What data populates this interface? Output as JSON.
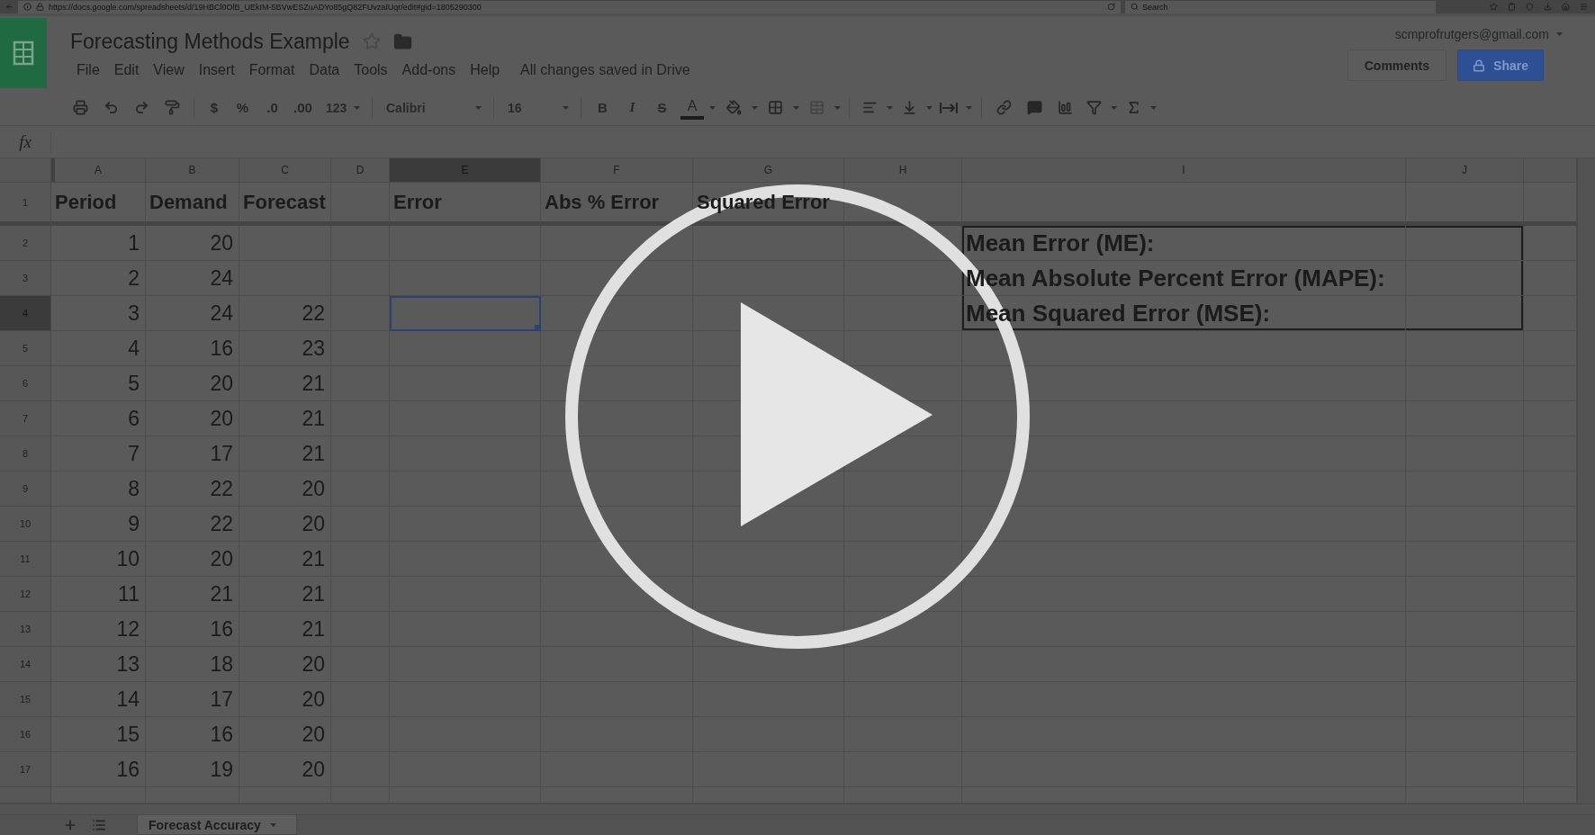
{
  "browser": {
    "url": "https://docs.google.com/spreadsheets/d/19HBCl0OlB_UEkIM-5BVwESZuADYo85gQ82FUvzaIUqr/edit#gid=1805290300",
    "search_placeholder": "Search"
  },
  "document": {
    "title": "Forecasting Methods Example",
    "starred": false,
    "menu": [
      "File",
      "Edit",
      "View",
      "Insert",
      "Format",
      "Data",
      "Tools",
      "Add-ons",
      "Help"
    ],
    "save_status": "All changes saved in Drive"
  },
  "account": {
    "email": "scmprofrutgers@gmail.com"
  },
  "buttons": [
    {
      "label": "Comments",
      "kind": "plain"
    },
    {
      "label": "Share",
      "kind": "primary"
    }
  ],
  "toolbar": {
    "currency": "$",
    "percent": "%",
    "decimal_decrease": ".0",
    "decimal_increase": ".00",
    "number_format": "123",
    "font": "Calibri",
    "font_size": "16",
    "bold": "B",
    "italic": "I",
    "strikethrough": "S",
    "text_color": "A"
  },
  "formula_bar": {
    "label": "fx"
  },
  "sheet": {
    "columns": [
      {
        "label": "A",
        "selected": false
      },
      {
        "label": "B",
        "selected": false
      },
      {
        "label": "C",
        "selected": false
      },
      {
        "label": "D",
        "selected": false
      },
      {
        "label": "E",
        "selected": true
      },
      {
        "label": "F",
        "selected": false
      },
      {
        "label": "G",
        "selected": false
      },
      {
        "label": "H",
        "selected": false
      },
      {
        "label": "I",
        "selected": false
      },
      {
        "label": "J",
        "selected": false
      }
    ],
    "rows": [
      {
        "number": "1",
        "selected": false,
        "frozen": true,
        "cells": [
          {
            "text": "Period",
            "kind": "header"
          },
          {
            "text": "Demand",
            "kind": "header"
          },
          {
            "text": "Forecast",
            "kind": "header"
          },
          null,
          {
            "text": "Error",
            "kind": "header"
          },
          {
            "text": "Abs % Error",
            "kind": "header"
          },
          {
            "text": "Squared Error",
            "kind": "header"
          }
        ]
      },
      {
        "number": "2",
        "selected": false,
        "frozen": false,
        "cells": [
          {
            "text": "1",
            "kind": "number"
          },
          {
            "text": "20",
            "kind": "number"
          },
          null,
          null,
          null,
          null,
          null,
          null,
          {
            "text": "Mean Error (ME):",
            "kind": "label"
          }
        ]
      },
      {
        "number": "3",
        "selected": false,
        "frozen": false,
        "cells": [
          {
            "text": "2",
            "kind": "number"
          },
          {
            "text": "24",
            "kind": "number"
          },
          null,
          null,
          null,
          null,
          null,
          null,
          {
            "text": "Mean Absolute Percent Error (MAPE):",
            "kind": "label"
          }
        ]
      },
      {
        "number": "4",
        "selected": true,
        "frozen": false,
        "cells": [
          {
            "text": "3",
            "kind": "number"
          },
          {
            "text": "24",
            "kind": "number"
          },
          {
            "text": "22",
            "kind": "number"
          },
          null,
          null,
          null,
          null,
          null,
          {
            "text": "Mean Squared Error (MSE):",
            "kind": "label"
          }
        ]
      },
      {
        "number": "5",
        "selected": false,
        "frozen": false,
        "cells": [
          {
            "text": "4",
            "kind": "number"
          },
          {
            "text": "16",
            "kind": "number"
          },
          {
            "text": "23",
            "kind": "number"
          }
        ]
      },
      {
        "number": "6",
        "selected": false,
        "frozen": false,
        "cells": [
          {
            "text": "5",
            "kind": "number"
          },
          {
            "text": "20",
            "kind": "number"
          },
          {
            "text": "21",
            "kind": "number"
          }
        ]
      },
      {
        "number": "7",
        "selected": false,
        "frozen": false,
        "cells": [
          {
            "text": "6",
            "kind": "number"
          },
          {
            "text": "20",
            "kind": "number"
          },
          {
            "text": "21",
            "kind": "number"
          }
        ]
      },
      {
        "number": "8",
        "selected": false,
        "frozen": false,
        "cells": [
          {
            "text": "7",
            "kind": "number"
          },
          {
            "text": "17",
            "kind": "number"
          },
          {
            "text": "21",
            "kind": "number"
          }
        ]
      },
      {
        "number": "9",
        "selected": false,
        "frozen": false,
        "cells": [
          {
            "text": "8",
            "kind": "number"
          },
          {
            "text": "22",
            "kind": "number"
          },
          {
            "text": "20",
            "kind": "number"
          }
        ]
      },
      {
        "number": "10",
        "selected": false,
        "frozen": false,
        "cells": [
          {
            "text": "9",
            "kind": "number"
          },
          {
            "text": "22",
            "kind": "number"
          },
          {
            "text": "20",
            "kind": "number"
          }
        ]
      },
      {
        "number": "11",
        "selected": false,
        "frozen": false,
        "cells": [
          {
            "text": "10",
            "kind": "number"
          },
          {
            "text": "20",
            "kind": "number"
          },
          {
            "text": "21",
            "kind": "number"
          }
        ]
      },
      {
        "number": "12",
        "selected": false,
        "frozen": false,
        "cells": [
          {
            "text": "11",
            "kind": "number"
          },
          {
            "text": "21",
            "kind": "number"
          },
          {
            "text": "21",
            "kind": "number"
          }
        ]
      },
      {
        "number": "13",
        "selected": false,
        "frozen": false,
        "cells": [
          {
            "text": "12",
            "kind": "number"
          },
          {
            "text": "16",
            "kind": "number"
          },
          {
            "text": "21",
            "kind": "number"
          }
        ]
      },
      {
        "number": "14",
        "selected": false,
        "frozen": false,
        "cells": [
          {
            "text": "13",
            "kind": "number"
          },
          {
            "text": "18",
            "kind": "number"
          },
          {
            "text": "20",
            "kind": "number"
          }
        ]
      },
      {
        "number": "15",
        "selected": false,
        "frozen": false,
        "cells": [
          {
            "text": "14",
            "kind": "number"
          },
          {
            "text": "17",
            "kind": "number"
          },
          {
            "text": "20",
            "kind": "number"
          }
        ]
      },
      {
        "number": "16",
        "selected": false,
        "frozen": false,
        "cells": [
          {
            "text": "15",
            "kind": "number"
          },
          {
            "text": "16",
            "kind": "number"
          },
          {
            "text": "20",
            "kind": "number"
          }
        ]
      },
      {
        "number": "17",
        "selected": false,
        "frozen": false,
        "cells": [
          {
            "text": "16",
            "kind": "number"
          },
          {
            "text": "19",
            "kind": "number"
          },
          {
            "text": "20",
            "kind": "number"
          }
        ]
      }
    ]
  },
  "sheet_tabs": [
    {
      "label": "Forecast Accuracy",
      "selected": true
    }
  ]
}
